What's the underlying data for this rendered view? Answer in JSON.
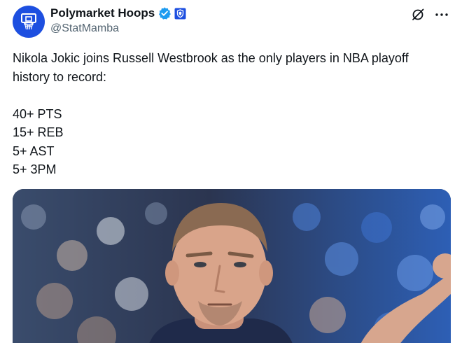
{
  "author": {
    "display_name": "Polymarket Hoops",
    "handle": "@StatMamba",
    "avatar_icon": "basketball-hoop-icon",
    "verified_badge_icon": "verified-check-icon",
    "affiliate_badge_icon": "affiliate-shield-icon",
    "colors": {
      "avatar_bg": "#1d4fe0",
      "verified": "#1d9bf0"
    }
  },
  "actions": {
    "grok_icon": "grok-icon",
    "more_icon": "more-options-icon"
  },
  "tweet": {
    "intro_line1": "Nikola Jokic joins Russell Westbrook as the only players in NBA playoff",
    "intro_line2": "history to record:",
    "stats": [
      "40+ PTS",
      "15+ REB",
      "5+ AST",
      "5+ 3PM"
    ]
  },
  "media": {
    "type": "photo",
    "colors": {
      "crowd": "#2f5fb8",
      "jersey": "#1f2a4a",
      "skin": "#d9a48a"
    }
  }
}
